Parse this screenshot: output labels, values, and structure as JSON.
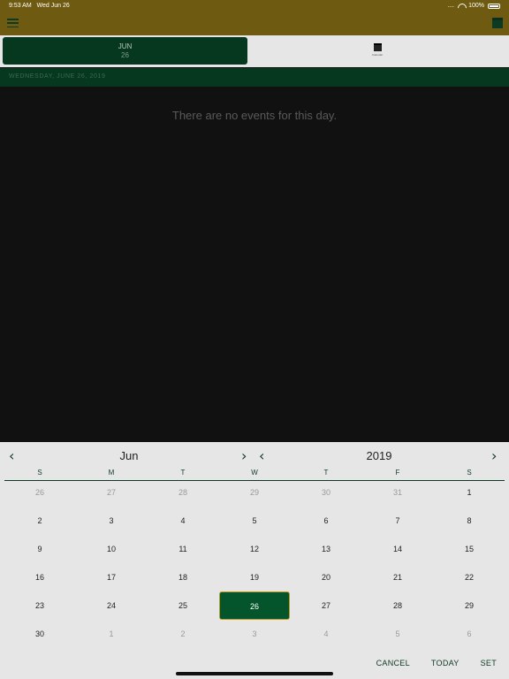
{
  "status_bar": {
    "time": "9:53 AM",
    "date": "Wed Jun 26",
    "signal": "....",
    "battery": "100%"
  },
  "top_bar": {
    "menu_icon": "hamburger-icon",
    "calendar_icon": "calendar-icon"
  },
  "tabs": {
    "date_tab": {
      "month": "JUN",
      "day": "26"
    },
    "calendar_tab": {
      "icon": "calendar-icon",
      "label": "Calendar"
    }
  },
  "day_header": "WEDNESDAY, JUNE 26, 2019",
  "content": {
    "empty_message": "There are no events for this day."
  },
  "picker": {
    "month": "Jun",
    "year": "2019",
    "weekdays": [
      "S",
      "M",
      "T",
      "W",
      "T",
      "F",
      "S"
    ],
    "weeks": [
      [
        {
          "d": "26",
          "muted": true
        },
        {
          "d": "27",
          "muted": true
        },
        {
          "d": "28",
          "muted": true
        },
        {
          "d": "29",
          "muted": true
        },
        {
          "d": "30",
          "muted": true
        },
        {
          "d": "31",
          "muted": true
        },
        {
          "d": "1",
          "muted": false
        }
      ],
      [
        {
          "d": "2",
          "muted": false
        },
        {
          "d": "3",
          "muted": false
        },
        {
          "d": "4",
          "muted": false
        },
        {
          "d": "5",
          "muted": false
        },
        {
          "d": "6",
          "muted": false
        },
        {
          "d": "7",
          "muted": false
        },
        {
          "d": "8",
          "muted": false
        }
      ],
      [
        {
          "d": "9",
          "muted": false
        },
        {
          "d": "10",
          "muted": false
        },
        {
          "d": "11",
          "muted": false
        },
        {
          "d": "12",
          "muted": false
        },
        {
          "d": "13",
          "muted": false
        },
        {
          "d": "14",
          "muted": false
        },
        {
          "d": "15",
          "muted": false
        }
      ],
      [
        {
          "d": "16",
          "muted": false
        },
        {
          "d": "17",
          "muted": false
        },
        {
          "d": "18",
          "muted": false
        },
        {
          "d": "19",
          "muted": false
        },
        {
          "d": "20",
          "muted": false
        },
        {
          "d": "21",
          "muted": false
        },
        {
          "d": "22",
          "muted": false
        }
      ],
      [
        {
          "d": "23",
          "muted": false
        },
        {
          "d": "24",
          "muted": false
        },
        {
          "d": "25",
          "muted": false
        },
        {
          "d": "26",
          "muted": false,
          "selected": true
        },
        {
          "d": "27",
          "muted": false
        },
        {
          "d": "28",
          "muted": false
        },
        {
          "d": "29",
          "muted": false
        }
      ],
      [
        {
          "d": "30",
          "muted": false
        },
        {
          "d": "1",
          "muted": true
        },
        {
          "d": "2",
          "muted": true
        },
        {
          "d": "3",
          "muted": true
        },
        {
          "d": "4",
          "muted": true
        },
        {
          "d": "5",
          "muted": true
        },
        {
          "d": "6",
          "muted": true
        }
      ]
    ],
    "actions": {
      "cancel": "CANCEL",
      "today": "TODAY",
      "set": "SET"
    }
  },
  "colors": {
    "gold": "#6e5a10",
    "dark_green": "#05381f",
    "selected_green": "#05552c",
    "selected_border": "#b79a1e"
  }
}
